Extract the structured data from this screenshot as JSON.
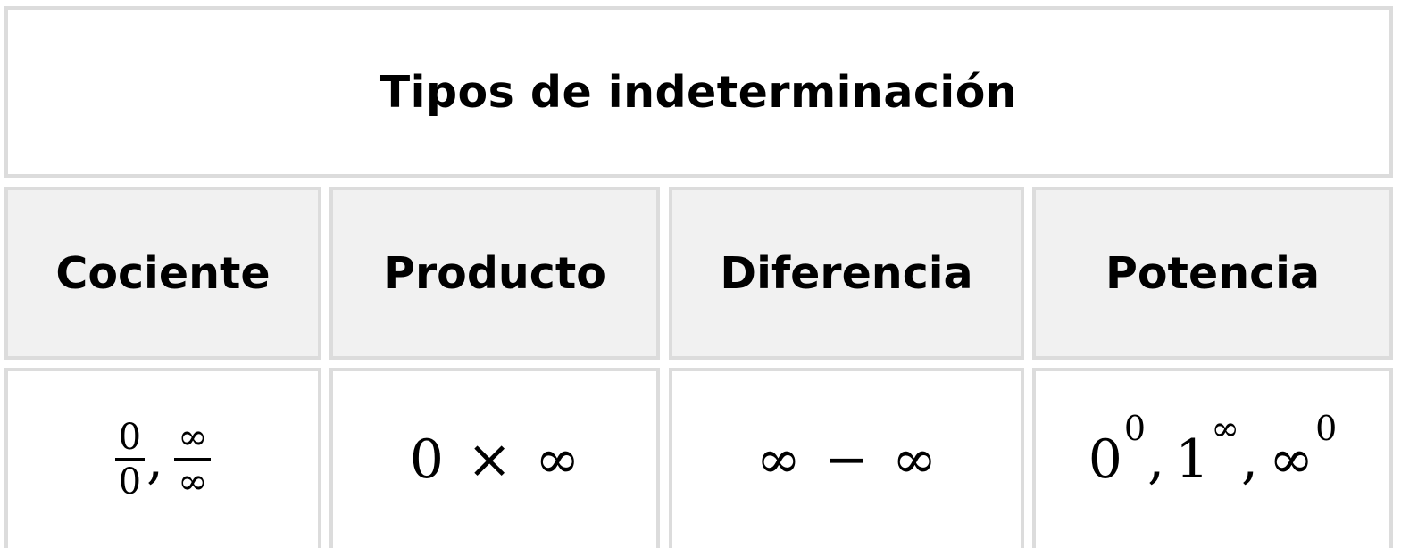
{
  "table": {
    "title": "Tipos de indeterminación",
    "headers": [
      "Cociente",
      "Producto",
      "Diferencia",
      "Potencia"
    ],
    "cociente": {
      "frac1": {
        "num": "0",
        "den": "0"
      },
      "separator": ",",
      "frac2": {
        "num": "∞",
        "den": "∞"
      }
    },
    "producto": {
      "left": "0",
      "op": "×",
      "right": "∞"
    },
    "diferencia": {
      "left": "∞",
      "op": "−",
      "right": "∞"
    },
    "potencia": [
      {
        "base": "0",
        "exp": "0",
        "sep": ","
      },
      {
        "base": "1",
        "exp": "∞",
        "sep": ","
      },
      {
        "base": "∞",
        "exp": "0",
        "sep": ""
      }
    ]
  }
}
